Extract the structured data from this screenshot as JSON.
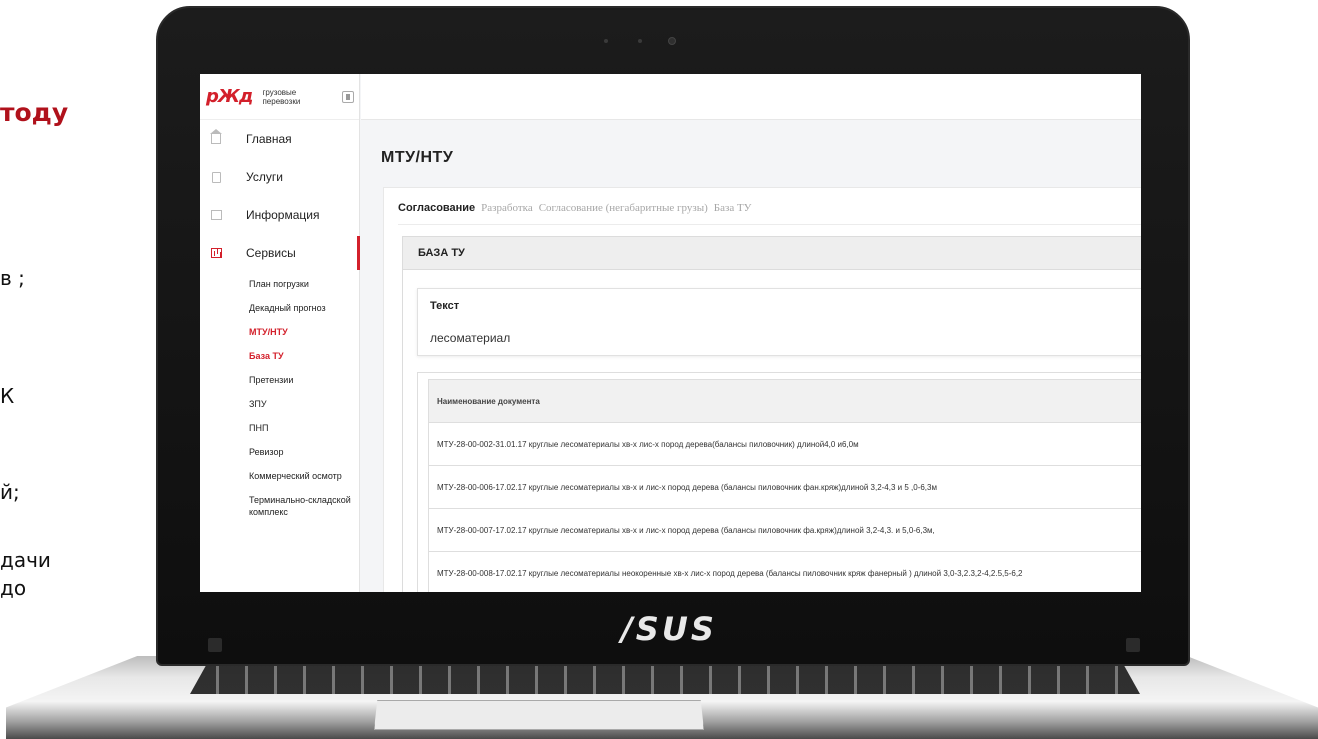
{
  "slide": {
    "title_fragment": "тоду",
    "line1": "в ;",
    "line2": "К",
    "line3": "й;",
    "line4a": "дачи",
    "line4b": "до"
  },
  "laptop": {
    "brand": "/SUS"
  },
  "app": {
    "logo_text": "рЖд",
    "logo_subtitle_line1": "грузовые",
    "logo_subtitle_line2": "перевозки"
  },
  "sidebar": {
    "items": [
      {
        "label": "Главная",
        "icon": "home-icon"
      },
      {
        "label": "Услуги",
        "icon": "document-icon"
      },
      {
        "label": "Информация",
        "icon": "info-icon"
      },
      {
        "label": "Сервисы",
        "icon": "chart-icon",
        "active": true
      }
    ],
    "sub_items": [
      {
        "label": "План погрузки"
      },
      {
        "label": "Декадный прогноз"
      },
      {
        "label": "МТУ/НТУ"
      },
      {
        "label": "База ТУ",
        "current": true
      },
      {
        "label": "Претензии"
      },
      {
        "label": "ЗПУ"
      },
      {
        "label": "ПНП"
      },
      {
        "label": "Ревизор"
      },
      {
        "label": "Коммерческий осмотр"
      },
      {
        "label": "Терминально-складской комплекс"
      }
    ]
  },
  "main": {
    "page_title": "МТУ/НТУ",
    "tabs": [
      {
        "label": "Согласование",
        "selected": true
      },
      {
        "label": "Разработка"
      },
      {
        "label": "Согласование (негабаритные грузы)"
      },
      {
        "label": "База ТУ"
      }
    ],
    "panel_header": "БАЗА ТУ",
    "search": {
      "label": "Текст",
      "value": "лесоматериал"
    },
    "table": {
      "header": "Наименование документа",
      "rows": [
        "МТУ-28-00-002-31.01.17 круглые лесоматериалы хв-х лис-х пород дерева(балансы пиловочник) длиной4,0 и6,0м",
        "МТУ-28-00-006-17.02.17 круглые лесоматериалы хв-х и лис-х пород дерева (балансы пиловочник фан.кряж)длиной 3,2-4,3 и 5 ,0-6,3м",
        "МТУ-28-00-007-17.02.17 круглые лесоматериалы хв-х и лис-х пород дерева (балансы пиловочник фа.кряж)длиной 3,2-4,3. и 5,0-6,3м,",
        "МТУ-28-00-008-17.02.17 круглые лесоматериалы неокоренные хв-х лис-х пород дерева (балансы пиловочник кряж фанерный ) длиной 3,0-3,2.3,2-4,2.5,5-6,2"
      ]
    }
  }
}
